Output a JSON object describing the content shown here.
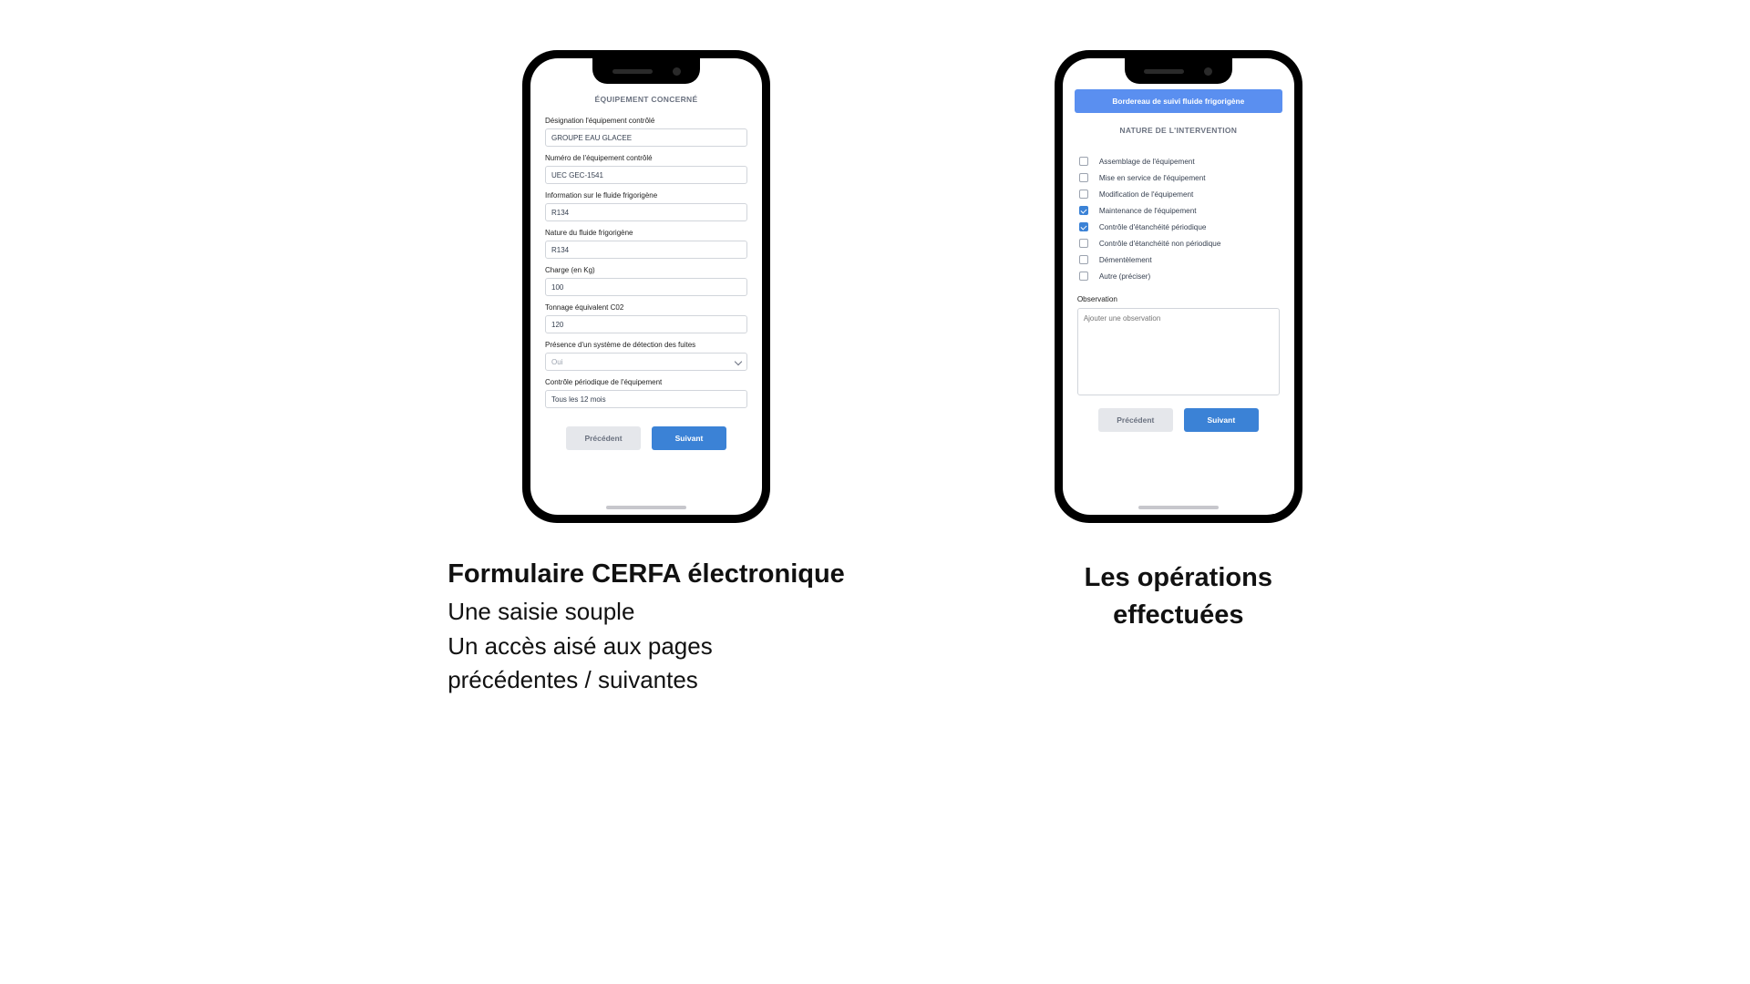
{
  "left": {
    "section_title": "ÉQUIPEMENT CONCERNÉ",
    "fields": {
      "designation": {
        "label": "Désignation l'équipement contrôlé",
        "value": "GROUPE EAU GLACEE"
      },
      "numero": {
        "label": "Numéro de l'équipement contrôlé",
        "value": "UEC GEC-1541"
      },
      "info_fluide": {
        "label": "Information sur le fluide frigorigène",
        "value": "R134"
      },
      "nature_fluide": {
        "label": "Nature du fluide frigorigène",
        "value": "R134"
      },
      "charge": {
        "label": "Charge (en Kg)",
        "value": "100"
      },
      "tonnage": {
        "label": "Tonnage équivalent C02",
        "value": "120"
      },
      "detection": {
        "label": "Présence d'un système de détection des fuites",
        "value": "Oui"
      },
      "controle": {
        "label": "Contrôle périodique de l'équipement",
        "value": "Tous les 12 mois"
      }
    },
    "buttons": {
      "prev": "Précédent",
      "next": "Suivant"
    },
    "caption_title": "Formulaire CERFA électronique",
    "caption_line1": "Une saisie souple",
    "caption_line2": "Un accès aisé aux pages",
    "caption_line3": "précédentes / suivantes"
  },
  "right": {
    "banner": "Bordereau de suivi fluide frigorigène",
    "section_title": "NATURE DE L'INTERVENTION",
    "options": [
      {
        "label": "Assemblage de l'équipement",
        "checked": false
      },
      {
        "label": "Mise en service de l'équipement",
        "checked": false
      },
      {
        "label": "Modification de l'équipement",
        "checked": false
      },
      {
        "label": "Maintenance de l'équipement",
        "checked": true
      },
      {
        "label": "Contrôle d'étanchéité périodique",
        "checked": true
      },
      {
        "label": "Contrôle d'étanchéité non périodique",
        "checked": false
      },
      {
        "label": "Démentèlement",
        "checked": false
      },
      {
        "label": "Autre (préciser)",
        "checked": false
      }
    ],
    "observation_label": "Observation",
    "observation_placeholder": "Ajouter une observation",
    "buttons": {
      "prev": "Précédent",
      "next": "Suivant"
    },
    "caption_title_1": "Les opérations",
    "caption_title_2": "effectuées"
  }
}
